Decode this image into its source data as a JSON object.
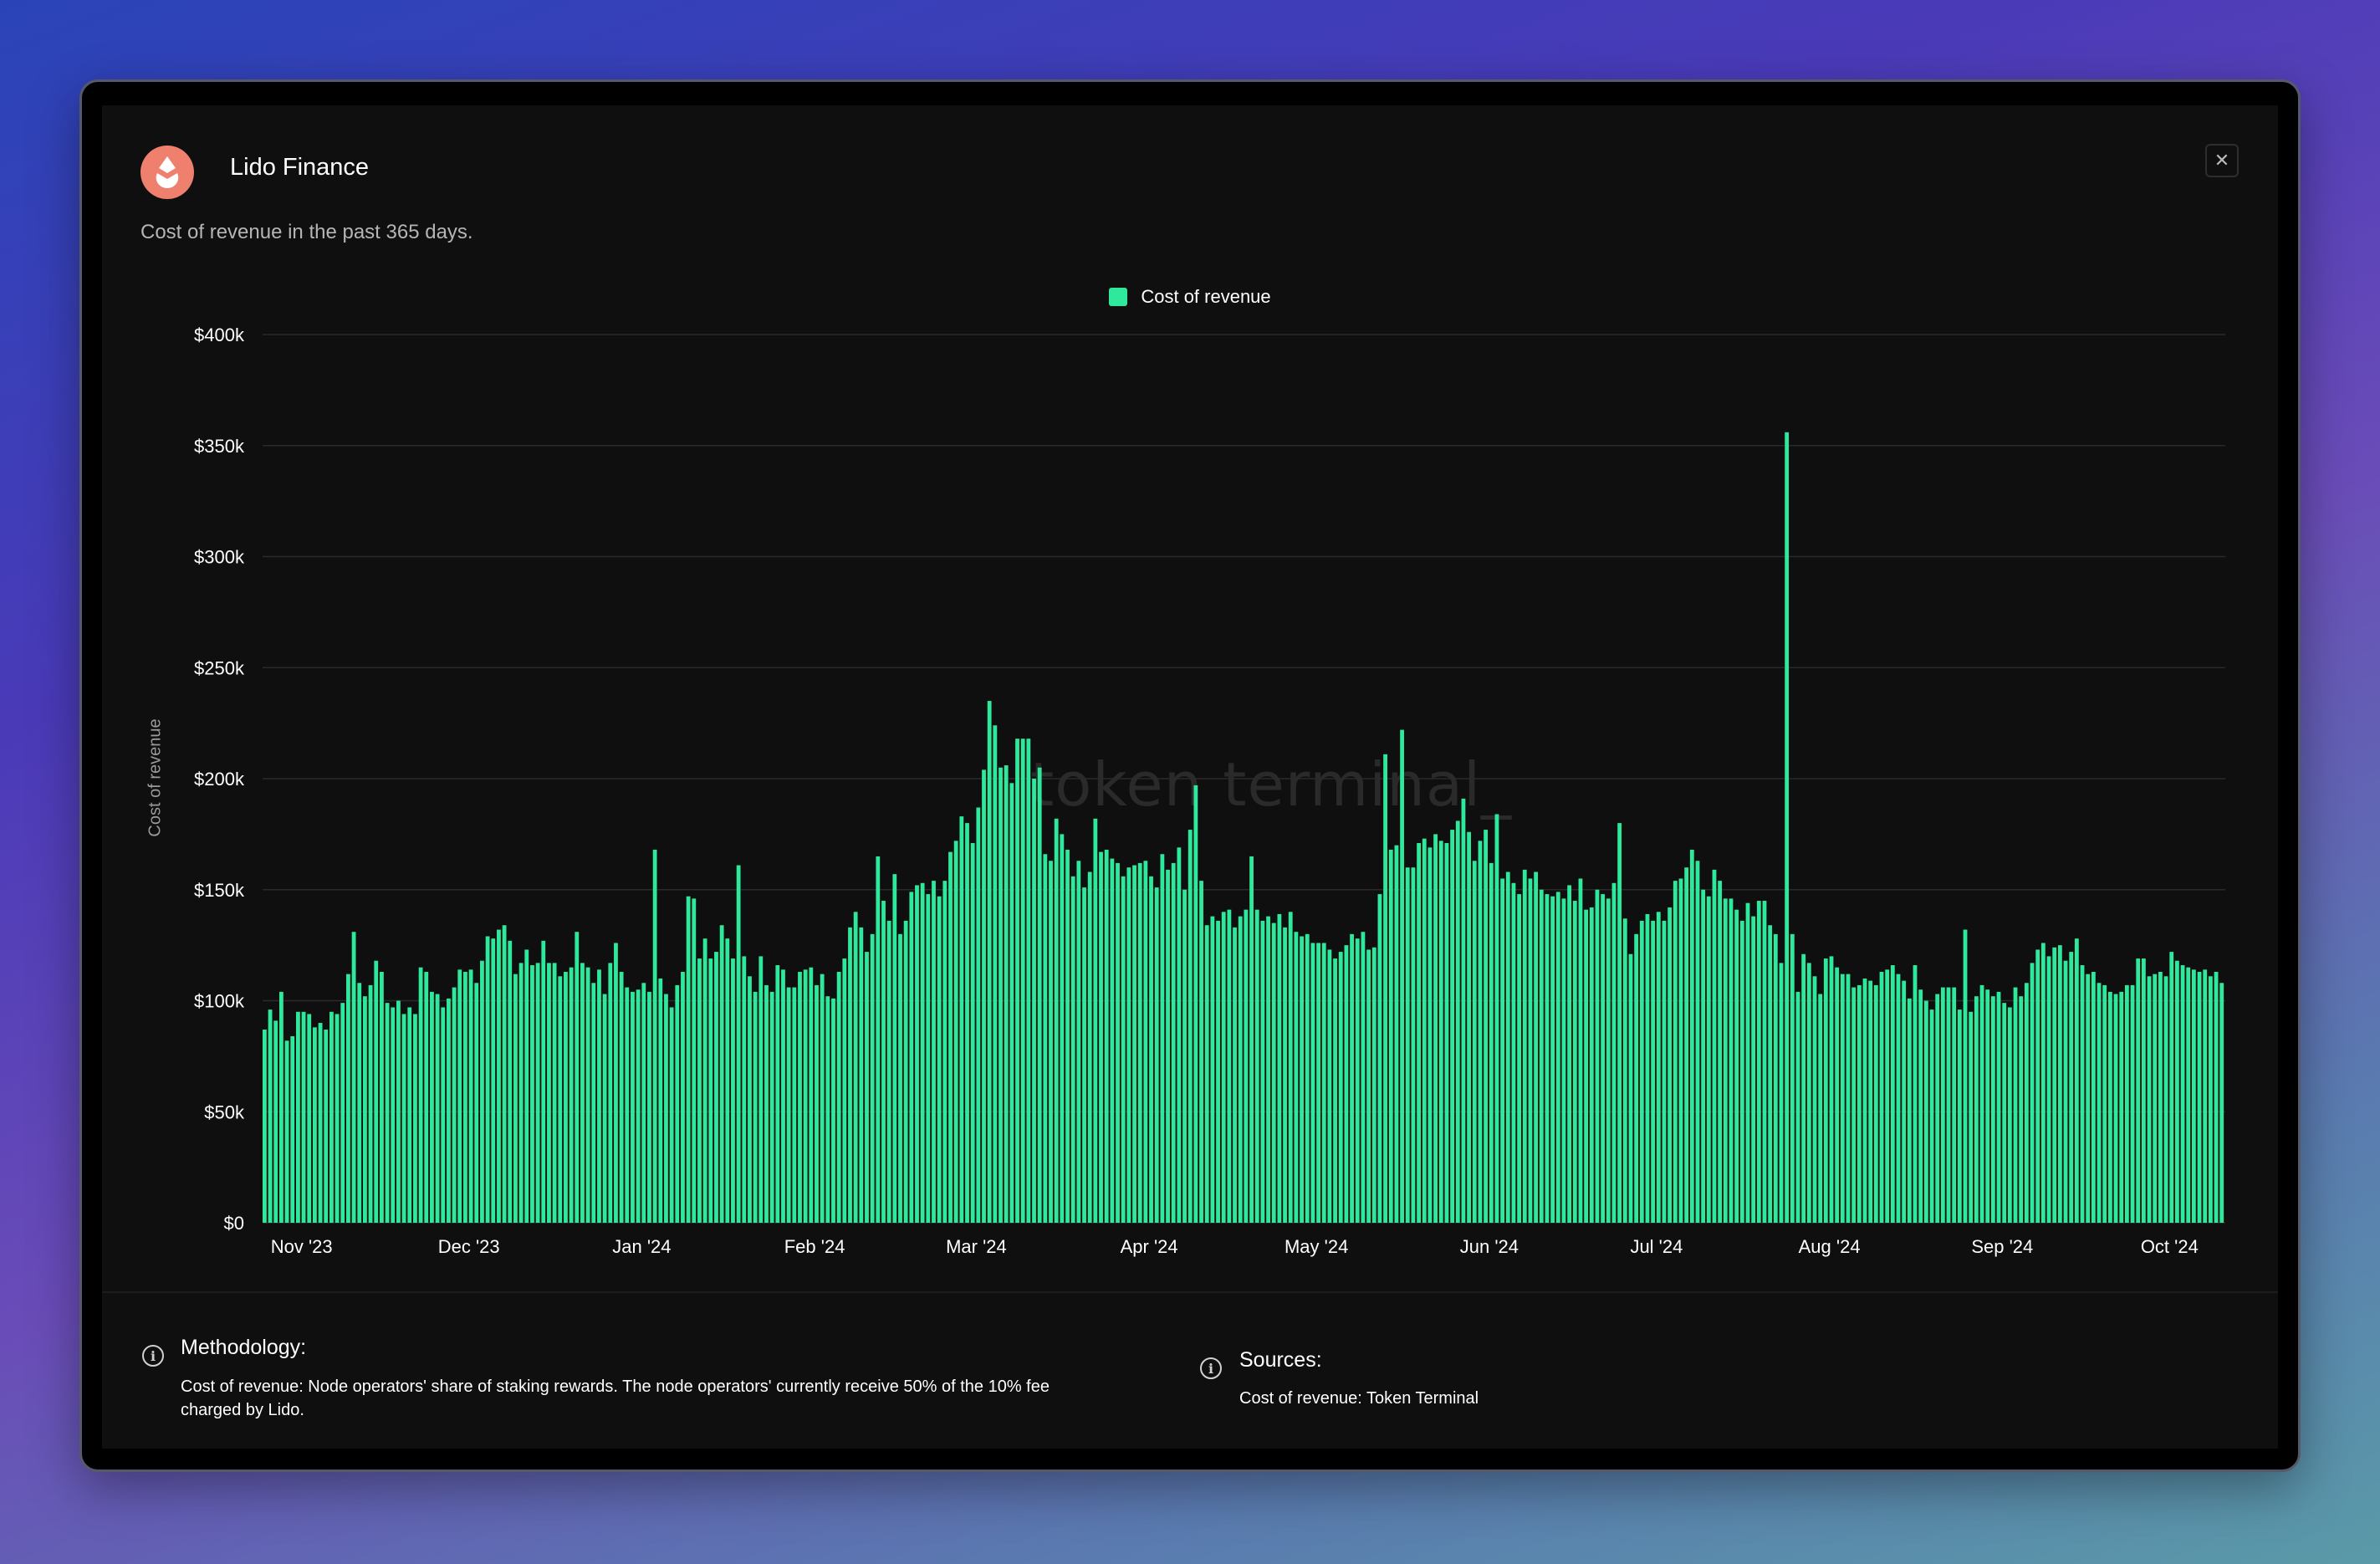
{
  "header": {
    "title": "Lido Finance",
    "subtitle": "Cost of revenue in the past 365 days.",
    "close_label": "✕"
  },
  "watermark": "token terminal_",
  "colors": {
    "bar": "#2ee89c",
    "background": "#0f0f0f",
    "grid": "#2a2a2a",
    "logo": "#f0806e"
  },
  "methodology": {
    "title": "Methodology:",
    "text_line1": "Cost of revenue: Node operators' share of staking rewards. The node operators' currently receive 50% of the 10% fee",
    "text_line2": "charged by Lido."
  },
  "sources": {
    "title": "Sources:",
    "text": "Cost of revenue: Token Terminal"
  },
  "chart_data": {
    "type": "bar",
    "legend": "Cost of revenue",
    "ylabel": "Cost of revenue",
    "ylim": [
      0,
      400000
    ],
    "yticks": [
      {
        "value": 0,
        "label": "$0"
      },
      {
        "value": 50000,
        "label": "$50k"
      },
      {
        "value": 100000,
        "label": "$100k"
      },
      {
        "value": 150000,
        "label": "$150k"
      },
      {
        "value": 200000,
        "label": "$200k"
      },
      {
        "value": 250000,
        "label": "$250k"
      },
      {
        "value": 300000,
        "label": "$300k"
      },
      {
        "value": 350000,
        "label": "$350k"
      },
      {
        "value": 400000,
        "label": "$400k"
      }
    ],
    "xticks": [
      {
        "label": "Nov '23",
        "index": 7
      },
      {
        "label": "Dec '23",
        "index": 37
      },
      {
        "label": "Jan '24",
        "index": 68
      },
      {
        "label": "Feb '24",
        "index": 99
      },
      {
        "label": "Mar '24",
        "index": 128
      },
      {
        "label": "Apr '24",
        "index": 159
      },
      {
        "label": "May '24",
        "index": 189
      },
      {
        "label": "Jun '24",
        "index": 220
      },
      {
        "label": "Jul '24",
        "index": 250
      },
      {
        "label": "Aug '24",
        "index": 281
      },
      {
        "label": "Sep '24",
        "index": 312
      },
      {
        "label": "Oct '24",
        "index": 342
      }
    ],
    "values": [
      87000,
      96000,
      91000,
      104000,
      82000,
      84000,
      95000,
      95000,
      94000,
      88000,
      90000,
      87000,
      95000,
      94000,
      99000,
      112000,
      131000,
      108000,
      102000,
      107000,
      118000,
      113000,
      99000,
      97000,
      100000,
      94000,
      97000,
      94000,
      115000,
      113000,
      104000,
      103000,
      97000,
      101000,
      106000,
      114000,
      113000,
      114000,
      108000,
      118000,
      129000,
      128000,
      132000,
      134000,
      127000,
      112000,
      117000,
      123000,
      116000,
      117000,
      127000,
      117000,
      117000,
      111000,
      113000,
      115000,
      131000,
      117000,
      115000,
      108000,
      114000,
      103000,
      117000,
      126000,
      113000,
      106000,
      104000,
      105000,
      108000,
      104000,
      168000,
      110000,
      103000,
      97000,
      107000,
      113000,
      147000,
      146000,
      119000,
      128000,
      119000,
      122000,
      134000,
      128000,
      119000,
      161000,
      120000,
      111000,
      104000,
      120000,
      107000,
      104000,
      116000,
      114000,
      106000,
      106000,
      113000,
      114000,
      115000,
      107000,
      112000,
      102000,
      101000,
      113000,
      119000,
      133000,
      140000,
      133000,
      122000,
      130000,
      165000,
      145000,
      136000,
      157000,
      130000,
      136000,
      149000,
      152000,
      153000,
      148000,
      154000,
      147000,
      154000,
      167000,
      172000,
      183000,
      180000,
      171000,
      187000,
      204000,
      235000,
      224000,
      205000,
      206000,
      198000,
      218000,
      218000,
      218000,
      200000,
      205000,
      166000,
      163000,
      182000,
      175000,
      168000,
      156000,
      163000,
      151000,
      158000,
      182000,
      167000,
      168000,
      164000,
      162000,
      156000,
      160000,
      161000,
      162000,
      163000,
      156000,
      151000,
      166000,
      159000,
      162000,
      169000,
      150000,
      177000,
      197000,
      154000,
      134000,
      138000,
      136000,
      140000,
      141000,
      133000,
      138000,
      141000,
      165000,
      141000,
      136000,
      138000,
      135000,
      139000,
      133000,
      140000,
      131000,
      129000,
      130000,
      126000,
      126000,
      126000,
      123000,
      119000,
      122000,
      125000,
      130000,
      128000,
      131000,
      123000,
      124000,
      148000,
      211000,
      168000,
      170000,
      222000,
      160000,
      160000,
      171000,
      173000,
      169000,
      175000,
      172000,
      171000,
      177000,
      181000,
      191000,
      176000,
      163000,
      172000,
      177000,
      162000,
      184000,
      155000,
      158000,
      153000,
      148000,
      159000,
      155000,
      158000,
      150000,
      148000,
      147000,
      149000,
      146000,
      152000,
      145000,
      155000,
      141000,
      142000,
      150000,
      148000,
      146000,
      153000,
      180000,
      137000,
      121000,
      130000,
      136000,
      139000,
      136000,
      140000,
      136000,
      142000,
      154000,
      155000,
      160000,
      168000,
      163000,
      150000,
      147000,
      159000,
      154000,
      146000,
      146000,
      141000,
      136000,
      144000,
      138000,
      145000,
      145000,
      134000,
      130000,
      117000,
      356000,
      130000,
      104000,
      121000,
      117000,
      111000,
      103000,
      119000,
      120000,
      115000,
      112000,
      112000,
      106000,
      107000,
      110000,
      109000,
      107000,
      113000,
      114000,
      116000,
      112000,
      109000,
      101000,
      116000,
      105000,
      100000,
      96000,
      103000,
      106000,
      106000,
      106000,
      96000,
      132000,
      95000,
      102000,
      107000,
      105000,
      102000,
      104000,
      99000,
      97000,
      106000,
      102000,
      108000,
      117000,
      123000,
      126000,
      120000,
      124000,
      125000,
      118000,
      122000,
      128000,
      116000,
      112000,
      113000,
      108000,
      107000,
      104000,
      103000,
      104000,
      107000,
      107000,
      119000,
      119000,
      111000,
      112000,
      113000,
      111000,
      122000,
      118000,
      116000,
      115000,
      114000,
      113000,
      114000,
      111000,
      113000,
      108000
    ]
  }
}
